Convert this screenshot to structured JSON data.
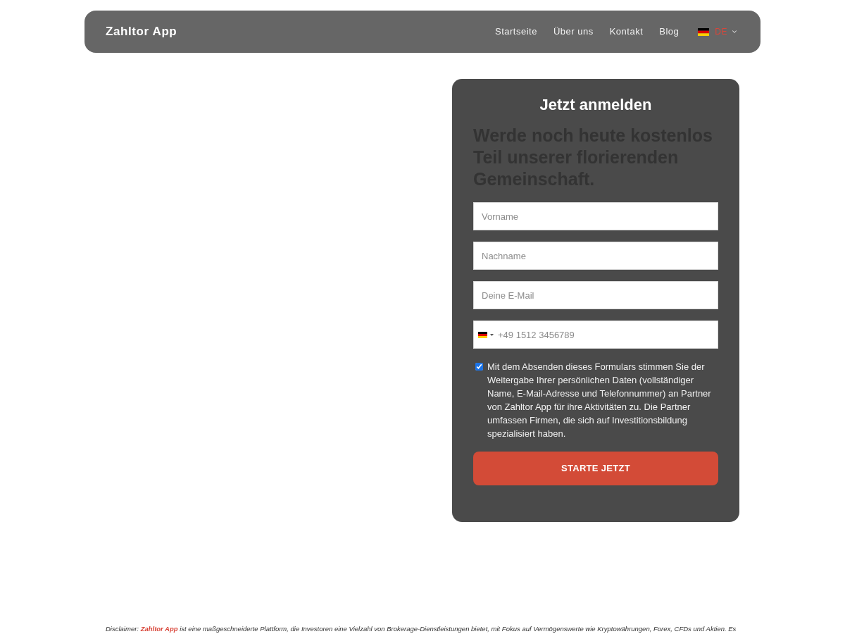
{
  "nav": {
    "brand": "Zahltor App",
    "links": [
      "Startseite",
      "Über uns",
      "Kontakt",
      "Blog"
    ],
    "language": {
      "code": "DE"
    }
  },
  "signup": {
    "title": "Jetzt anmelden",
    "headline": "Werde noch heute kostenlos Teil unserer florierenden Gemeinschaft.",
    "fields": [
      {
        "kind": "text",
        "placeholder": "Vorname"
      },
      {
        "kind": "text",
        "placeholder": "Nachname"
      },
      {
        "kind": "email",
        "placeholder": "Deine E-Mail"
      },
      {
        "kind": "phone",
        "placeholder": "+49 1512 3456789"
      }
    ],
    "consent": {
      "checked": true,
      "text": "Mit dem Absenden dieses Formulars stimmen Sie der Weitergabe Ihrer persönlichen Daten (vollständiger Name, E-Mail-Adresse und Telefonnummer) an Partner von Zahltor App für ihre Aktivitäten zu. Die Partner umfassen Firmen, die sich auf Investitionsbildung spezialisiert haben."
    },
    "submit": "STARTE JETZT"
  },
  "disclaimer": {
    "label": "Disclaimer:",
    "link": "Zahltor App",
    "text": "ist eine maßgeschneiderte Plattform, die Investoren eine Vielzahl von Brokerage-Dienstleistungen bietet, mit Fokus auf Vermögenswerte wie Kryptowährungen, Forex, CFDs und Aktien. Es"
  }
}
